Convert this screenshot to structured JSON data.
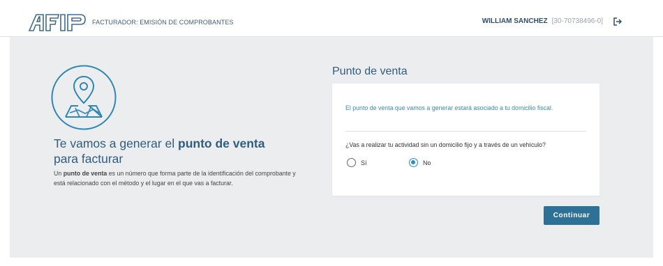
{
  "header": {
    "logo_text": "AFIP",
    "app_title": "FACTURADOR: EMISIÓN DE COMPROBANTES",
    "user_name": "WILLIAM SANCHEZ",
    "user_cuit": "[30-70738496-0]",
    "logout_icon": "logout-icon"
  },
  "intro": {
    "icon": "location-map-icon",
    "title_prefix": "Te vamos a generar el ",
    "title_bold": "punto de venta",
    "title_suffix": "para facturar",
    "desc_prefix": "Un ",
    "desc_bold": "punto de venta",
    "desc_suffix": " es un número que forma parte de la identificación del comprobante y está relacionado con el método y el lugar en el que vas a facturar."
  },
  "form": {
    "section_title": "Punto de venta",
    "info_text": "El punto de venta que vamos a generar estará asociado a tu domicilio fiscal.",
    "question": "¿Vas a realizar tu actividad sin un domicilio fijo y a través de un vehículo?",
    "options": [
      {
        "label": "Sí",
        "checked": false
      },
      {
        "label": "No",
        "checked": true
      }
    ],
    "continue_label": "Continuar"
  },
  "colors": {
    "accent": "#2e7196",
    "title_blue": "#2f5d80",
    "info_blue": "#3a8ab0",
    "radio_selected": "#2a8ec8",
    "panel_bg": "#ecedef"
  }
}
